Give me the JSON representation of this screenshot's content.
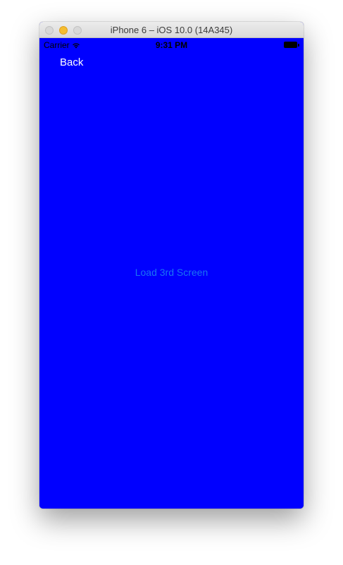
{
  "window": {
    "title": "iPhone 6 – iOS 10.0 (14A345)"
  },
  "status_bar": {
    "carrier": "Carrier",
    "time": "9:31 PM"
  },
  "nav": {
    "back_label": "Back"
  },
  "main": {
    "load_button_label": "Load 3rd Screen"
  },
  "colors": {
    "screen_background": "#0000ff",
    "load_button_text": "#1a74f2",
    "back_button_text": "#ffffff"
  }
}
